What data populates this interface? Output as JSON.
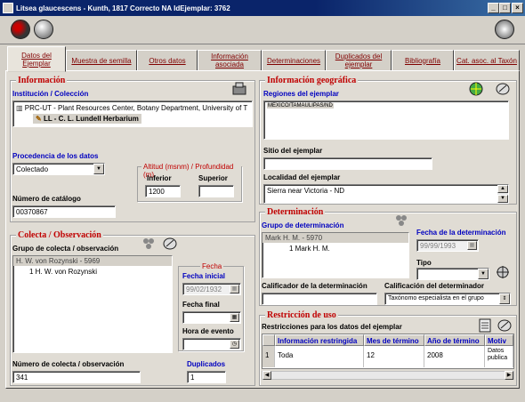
{
  "window": {
    "title": "Litsea glaucescens - Kunth, 1817  Correcto   NA  IdEjemplar: 3762",
    "min": "_",
    "max": "□",
    "close": "×"
  },
  "tabs": [
    {
      "label": "Datos del Ejemplar"
    },
    {
      "label": "Muestra de semilla"
    },
    {
      "label": "Otros datos"
    },
    {
      "label": "Información asociada"
    },
    {
      "label": "Determinaciones"
    },
    {
      "label": "Duplicados del ejemplar"
    },
    {
      "label": "Bibliografía"
    },
    {
      "label": "Cat. asoc. al  Taxón"
    }
  ],
  "informacion": {
    "title": "Información",
    "institucion_label": "Institución / Colección",
    "tree_root": "PRC-UT - Plant Resources Center, Botany Department, University of T",
    "tree_child": "LL - C. L. Lundell Herbarium",
    "procedencia_label": "Procedencia de los datos",
    "procedencia_value": "Colectado",
    "altitud_label": "Altitud (msnm) / Profundidad (m)",
    "inferior_label": "Inferior",
    "inferior_value": "1200",
    "superior_label": "Superior",
    "superior_value": "",
    "catalogo_label": "Número de catálogo",
    "catalogo_value": "00370867"
  },
  "geografica": {
    "title": "Información geográfica",
    "regiones_label": "Regiones del ejemplar",
    "regiones_value": "MEXICO/TAMAULIPAS/ND",
    "sitio_label": "Sitio del ejemplar",
    "sitio_value": "",
    "localidad_label": "Localidad del ejemplar",
    "localidad_value": "Sierra near Victoria - ND"
  },
  "colecta": {
    "title": "Colecta / Observación",
    "grupo_label": "Grupo de colecta / observación",
    "grupo_header": "H. W. von Rozynski - 5969",
    "grupo_item": "1 H. W. von Rozynski",
    "fecha_title": "Fecha",
    "fecha_inicial_label": "Fecha inicial",
    "fecha_inicial_value": "99/02/1932",
    "fecha_final_label": "Fecha final",
    "fecha_final_value": "",
    "hora_label": "Hora de evento",
    "hora_value": "",
    "numero_label": "Número de colecta / observación",
    "numero_value": "341",
    "duplicados_label": "Duplicados",
    "duplicados_value": "1"
  },
  "determinacion": {
    "title": "Determinación",
    "grupo_label": "Grupo de determinación",
    "grupo_header": "Mark H. M. - 5970",
    "grupo_item": "1 Mark H. M.",
    "fecha_label": "Fecha de la determinación",
    "fecha_value": "99/99/1993",
    "tipo_label": "Tipo",
    "tipo_value": "",
    "calificador_label": "Calificador de la determinación",
    "calificador_value": "",
    "calificacion_label": "Calificación del determinador",
    "calificacion_value": "Taxónomo especialista en el grupo"
  },
  "restriccion": {
    "title": "Restricción de uso",
    "sub_label": "Restricciones para los datos del ejemplar",
    "columns": [
      "Información restringida",
      "Mes de término",
      "Año de término",
      "Motiv"
    ],
    "rows": [
      {
        "num": "1",
        "info": "Toda",
        "mes": "12",
        "anio": "2008",
        "motivo": "Datos publica"
      }
    ]
  },
  "colors": {
    "title_bg": "#0a246a",
    "section_title": "#c00000",
    "label_blue": "#0000c0",
    "tab_text": "#800000"
  }
}
